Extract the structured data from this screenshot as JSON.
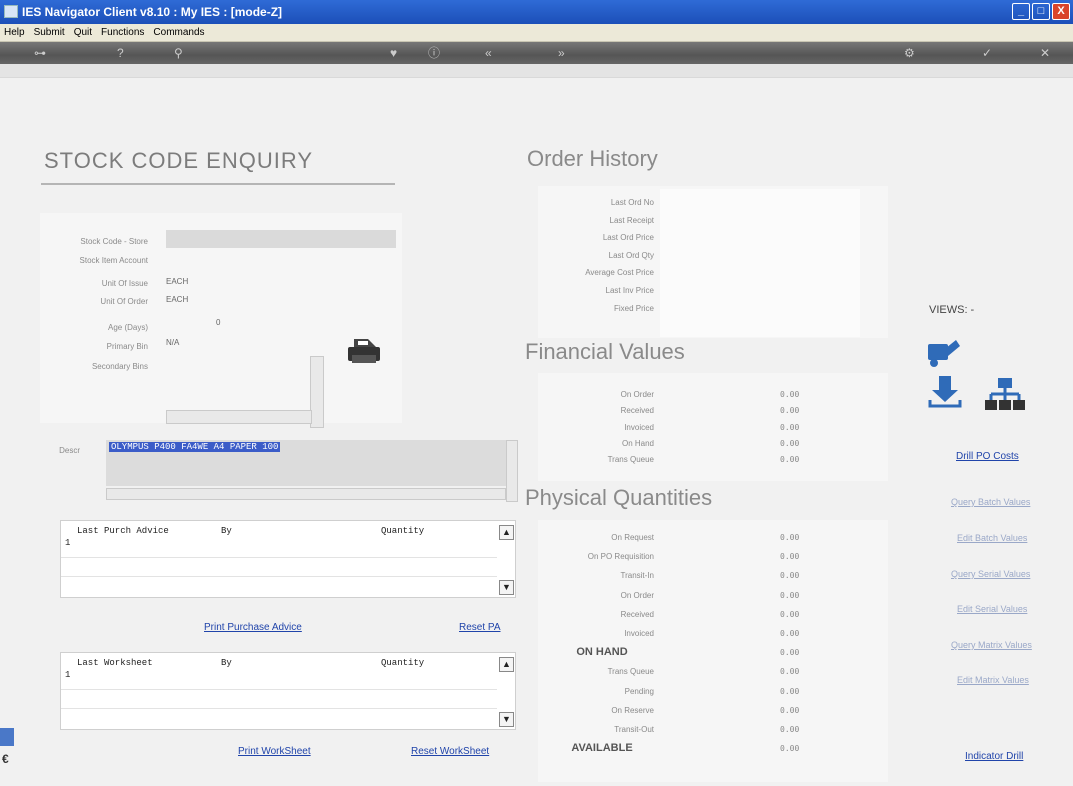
{
  "window": {
    "title": "IES Navigator Client v8.10 : My IES :      [mode-Z]",
    "minimize": "_",
    "maximize": "□",
    "close": "X"
  },
  "menu": [
    "Help",
    "Submit",
    "Quit",
    "Functions",
    "Commands"
  ],
  "toolbar": {
    "key": "⊶",
    "help": "?",
    "search": "⚲",
    "fav": "♥",
    "info": "ⓘ",
    "first": "«",
    "last": "»",
    "settings": "⚙",
    "ok": "✓",
    "cancel": "✕"
  },
  "left": {
    "heading": "STOCK  CODE  ENQUIRY",
    "stock_code_store_label": "Stock Code - Store",
    "stock_item_account_label": "Stock Item Account",
    "unit_of_issue_label": "Unit Of Issue",
    "unit_of_issue": "EACH",
    "unit_of_order_label": "Unit Of Order",
    "unit_of_order": "EACH",
    "age_label": "Age (Days)",
    "age": "0",
    "primary_bin_label": "Primary Bin",
    "primary_bin": "N/A",
    "secondary_bins_label": "Secondary Bins",
    "descr_label": "Descr",
    "descr": "OLYMPUS P400 FA4WE A4 PAPER 100",
    "purch_grid": {
      "col1": "Last Purch Advice",
      "col2": "By",
      "col3": "Quantity",
      "row_no": "1"
    },
    "print_purchase_advice": "Print Purchase Advice",
    "reset_pa": "Reset PA",
    "work_grid": {
      "col1": "Last Worksheet",
      "col2": "By",
      "col3": "Quantity",
      "row_no": "1"
    },
    "print_worksheet": "Print WorkSheet",
    "reset_worksheet": "Reset WorkSheet"
  },
  "order_history": {
    "heading": "Order History",
    "labels": [
      "Last Ord No",
      "Last Receipt",
      "Last Ord Price",
      "Last Ord Qty",
      "Average Cost Price",
      "Last Inv Price",
      "Fixed Price"
    ]
  },
  "financial": {
    "heading": "Financial Values",
    "rows": [
      {
        "label": "On Order",
        "value": "0.00"
      },
      {
        "label": "Received",
        "value": "0.00"
      },
      {
        "label": "Invoiced",
        "value": "0.00"
      },
      {
        "label": "On Hand",
        "value": "0.00"
      },
      {
        "label": "Trans Queue",
        "value": "0.00"
      }
    ]
  },
  "physical": {
    "heading": "Physical Quantities",
    "rows": [
      {
        "label": "On Request",
        "value": "0.00"
      },
      {
        "label": "On PO Requisition",
        "value": "0.00"
      },
      {
        "label": "Transit-In",
        "value": "0.00"
      },
      {
        "label": "On Order",
        "value": "0.00"
      },
      {
        "label": "Received",
        "value": "0.00"
      },
      {
        "label": "Invoiced",
        "value": "0.00"
      },
      {
        "label": "ON HAND",
        "value": "0.00"
      },
      {
        "label": "Trans Queue",
        "value": "0.00"
      },
      {
        "label": "Pending",
        "value": "0.00"
      },
      {
        "label": "On Reserve",
        "value": "0.00"
      },
      {
        "label": "Transit-Out",
        "value": "0.00"
      },
      {
        "label": "AVAILABLE",
        "value": "0.00"
      }
    ]
  },
  "views": {
    "label": "VIEWS: -",
    "drill_po_costs": "Drill PO Costs",
    "query_batch_values": "Query Batch Values",
    "edit_batch_values": "Edit Batch Values",
    "query_serial_values": "Query Serial Values",
    "edit_serial_values": "Edit Serial Values",
    "query_matrix_values": "Query Matrix Values",
    "edit_matrix_values": "Edit Matrix Values",
    "indicator_drill": "Indicator Drill"
  },
  "colors": {
    "title_bar": "#2f6bd6",
    "selection": "#3b5cc8",
    "link": "#2044aa"
  }
}
